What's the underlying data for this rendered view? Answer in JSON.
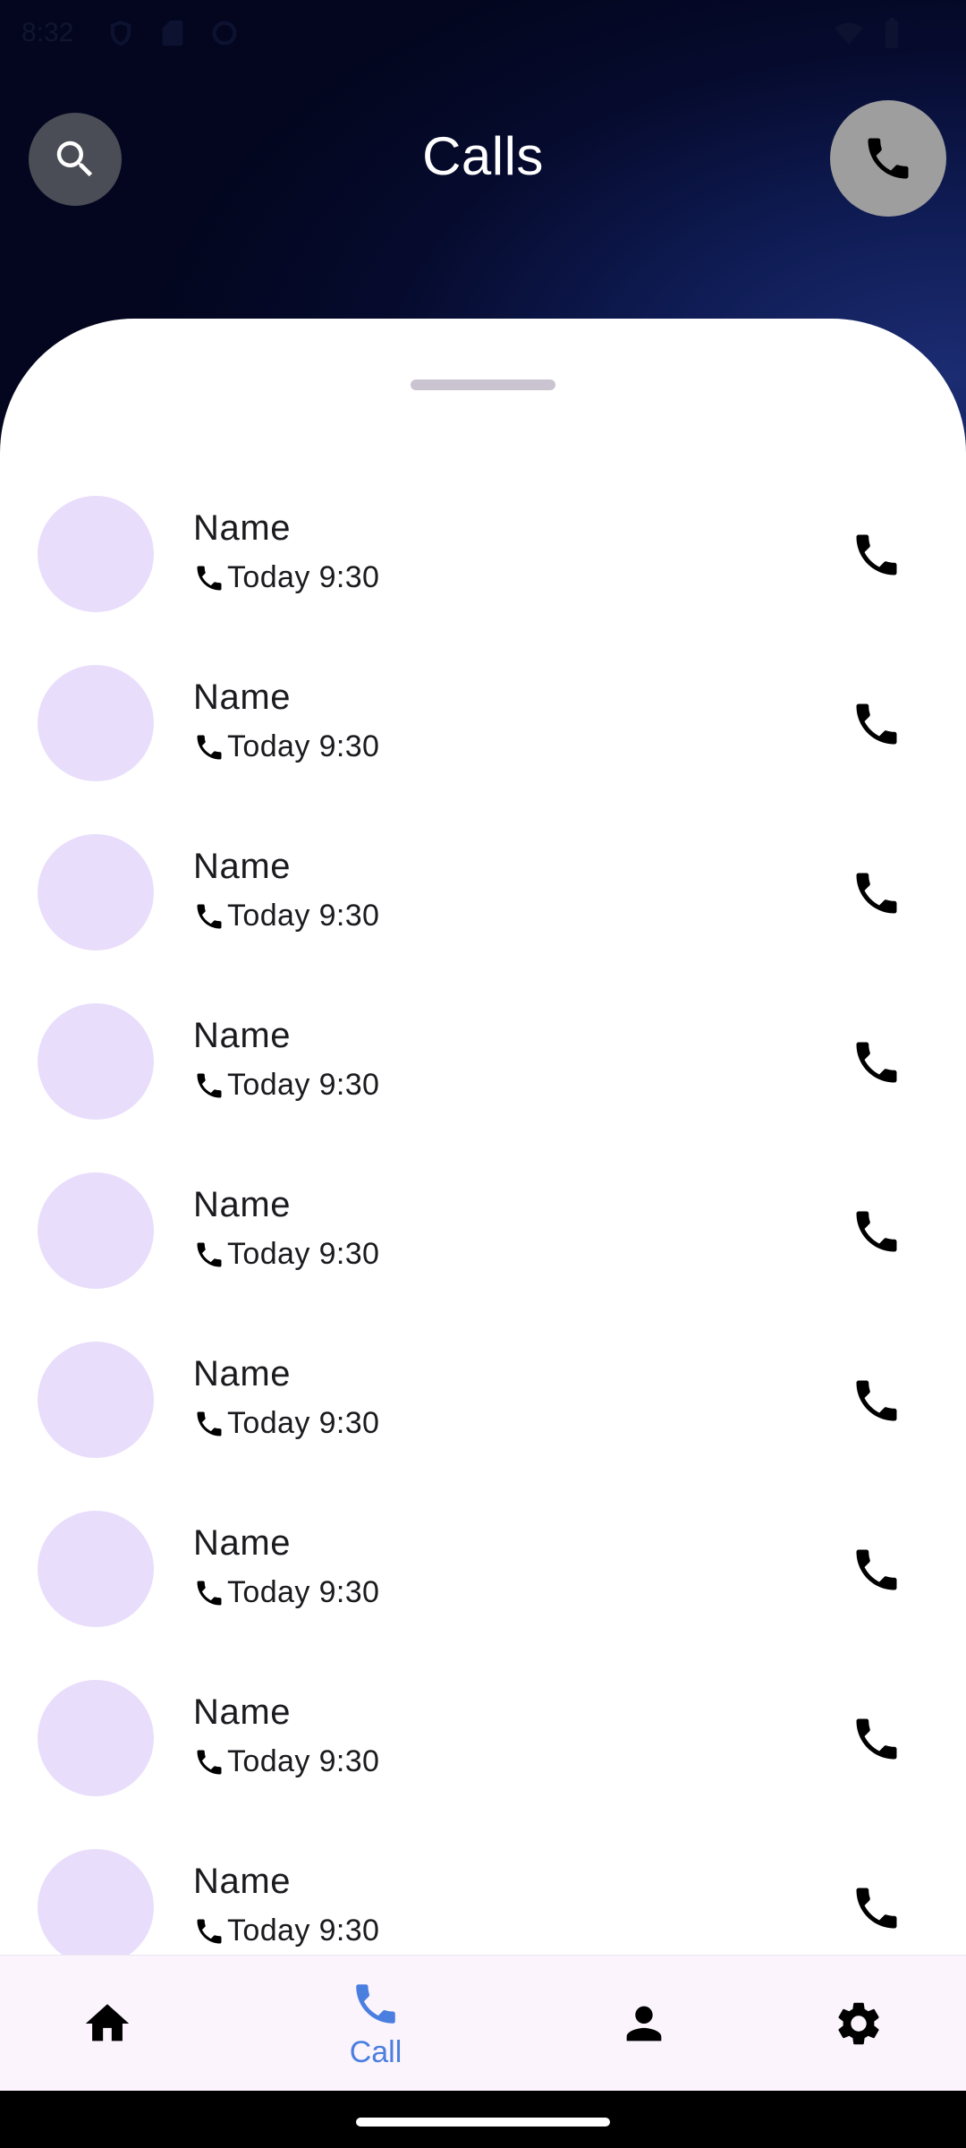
{
  "status_bar": {
    "time": "8:32"
  },
  "header": {
    "title": "Calls"
  },
  "calls": [
    {
      "name": "Name",
      "time": "Today 9:30"
    },
    {
      "name": "Name",
      "time": "Today 9:30"
    },
    {
      "name": "Name",
      "time": "Today 9:30"
    },
    {
      "name": "Name",
      "time": "Today 9:30"
    },
    {
      "name": "Name",
      "time": "Today 9:30"
    },
    {
      "name": "Name",
      "time": "Today 9:30"
    },
    {
      "name": "Name",
      "time": "Today 9:30"
    },
    {
      "name": "Name",
      "time": "Today 9:30"
    },
    {
      "name": "Name",
      "time": "Today 9:30"
    }
  ],
  "bottom_nav": {
    "items": [
      {
        "icon": "home-icon",
        "label": ""
      },
      {
        "icon": "phone-icon",
        "label": "Call",
        "active": true
      },
      {
        "icon": "person-icon",
        "label": ""
      },
      {
        "icon": "settings-icon",
        "label": ""
      }
    ]
  },
  "colors": {
    "accent": "#4a7fe0",
    "avatar_placeholder": "#e9ddfc",
    "nav_background": "#fbf4fd"
  }
}
